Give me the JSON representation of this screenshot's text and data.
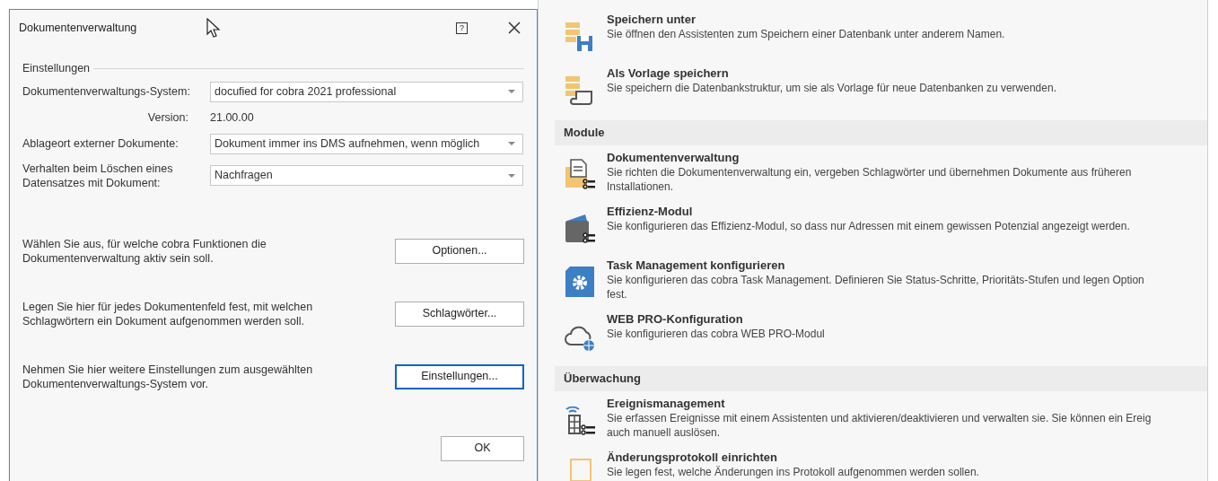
{
  "dialog": {
    "title": "Dokumentenverwaltung",
    "help": "?",
    "group_title": "Einstellungen",
    "fields": [
      {
        "kind": "combo",
        "label": "Dokumentenverwaltungs-System:",
        "value": "docufied for cobra 2021 professional"
      },
      {
        "kind": "text",
        "label": "Version:",
        "value": "21.00.00"
      },
      {
        "kind": "combo",
        "label": "Ablageort externer Dokumente:",
        "value": "Dokument immer ins DMS aufnehmen, wenn möglich"
      },
      {
        "kind": "combo",
        "label": "Verhalten beim Löschen eines Datensatzes mit Dokument:",
        "value": "Nachfragen"
      }
    ],
    "actions": [
      {
        "text": "Wählen Sie aus, für welche cobra Funktionen die Dokumentenverwaltung aktiv sein soll.",
        "button": "Optionen...",
        "focused": false
      },
      {
        "text": "Legen Sie hier für jedes Dokumentenfeld fest, mit welchen Schlagwörtern ein Dokument aufgenommen werden soll.",
        "button": "Schlagwörter...",
        "focused": false
      },
      {
        "text": "Nehmen Sie hier weitere Einstellungen zum ausgewählten Dokumentenverwaltungs-System vor.",
        "button": "Einstellungen...",
        "focused": true
      }
    ],
    "ok": "OK"
  },
  "panel": {
    "sections": [
      {
        "items": [
          {
            "title": "Speichern unter",
            "lines": [
              "Sie öffnen den Assistenten zum Speichern einer Datenbank unter anderem Namen."
            ]
          },
          {
            "title": "Als Vorlage speichern",
            "lines": [
              "Sie speichern die Datenbankstruktur, um sie als Vorlage für neue Datenbanken zu verwenden."
            ]
          }
        ]
      },
      {
        "header": "Module",
        "items": [
          {
            "title": "Dokumentenverwaltung",
            "lines": [
              "Sie richten die Dokumentenverwaltung ein, vergeben Schlagwörter und übernehmen Dokumente aus früheren",
              "Installationen."
            ]
          },
          {
            "title": "Effizienz-Modul",
            "lines": [
              "Sie konfigurieren das Effizienz-Modul, so dass nur Adressen mit einem gewissen Potenzial angezeigt werden."
            ]
          },
          {
            "title": "Task Management konfigurieren",
            "lines": [
              "Sie konfigurieren das cobra Task Management. Definieren Sie Status-Schritte, Prioritäts-Stufen und legen Option",
              "fest."
            ]
          },
          {
            "title": "WEB PRO-Konfiguration",
            "lines": [
              "Sie konfigurieren das cobra WEB PRO-Modul"
            ]
          }
        ]
      },
      {
        "header": "Überwachung",
        "items": [
          {
            "title": "Ereignismanagement",
            "lines": [
              "Sie erfassen Ereignisse mit einem Assistenten und aktivieren/deaktivieren und verwalten sie. Sie können ein Ereig",
              "auch manuell auslösen."
            ]
          },
          {
            "title": "Änderungsprotokoll einrichten",
            "lines": [
              "Sie legen fest, welche Änderungen ins Protokoll aufgenommen werden sollen."
            ]
          }
        ]
      }
    ]
  }
}
